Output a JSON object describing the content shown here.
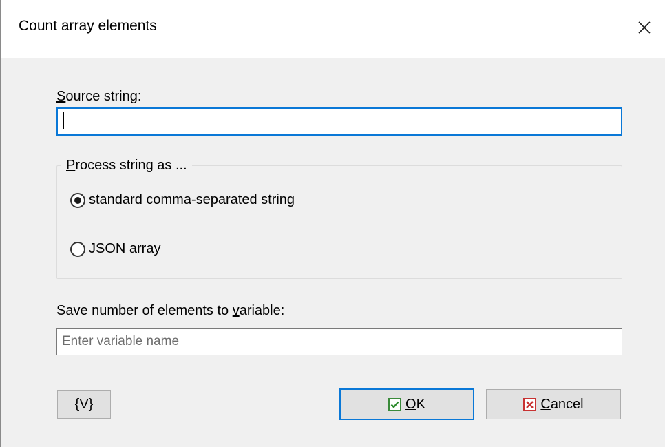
{
  "dialog": {
    "title": "Count array elements",
    "close_icon": "close-x-icon"
  },
  "source": {
    "label": "Source string:",
    "label_underline_char": "S",
    "label_rest": "ource string:",
    "value": ""
  },
  "process_group": {
    "legend_underline_char": "P",
    "legend_rest": "rocess string as ...",
    "options": [
      {
        "label": "standard comma-separated string",
        "selected": true
      },
      {
        "label": "JSON array",
        "selected": false
      }
    ]
  },
  "variable": {
    "label_before": "Save number of elements to ",
    "label_underline_char": "v",
    "label_after": "ariable:",
    "placeholder": "Enter variable name",
    "value": ""
  },
  "buttons": {
    "vars_label": "{V}",
    "ok_underline_char": "O",
    "ok_rest": "K",
    "ok_icon": "checkmark-icon",
    "cancel_underline_char": "C",
    "cancel_rest": "ancel",
    "cancel_icon": "x-mark-icon"
  },
  "colors": {
    "focus_border": "#0a78d7",
    "dialog_bg": "#f0f0f0",
    "ok_check": "#3a8a3a",
    "cancel_x": "#c83232"
  }
}
